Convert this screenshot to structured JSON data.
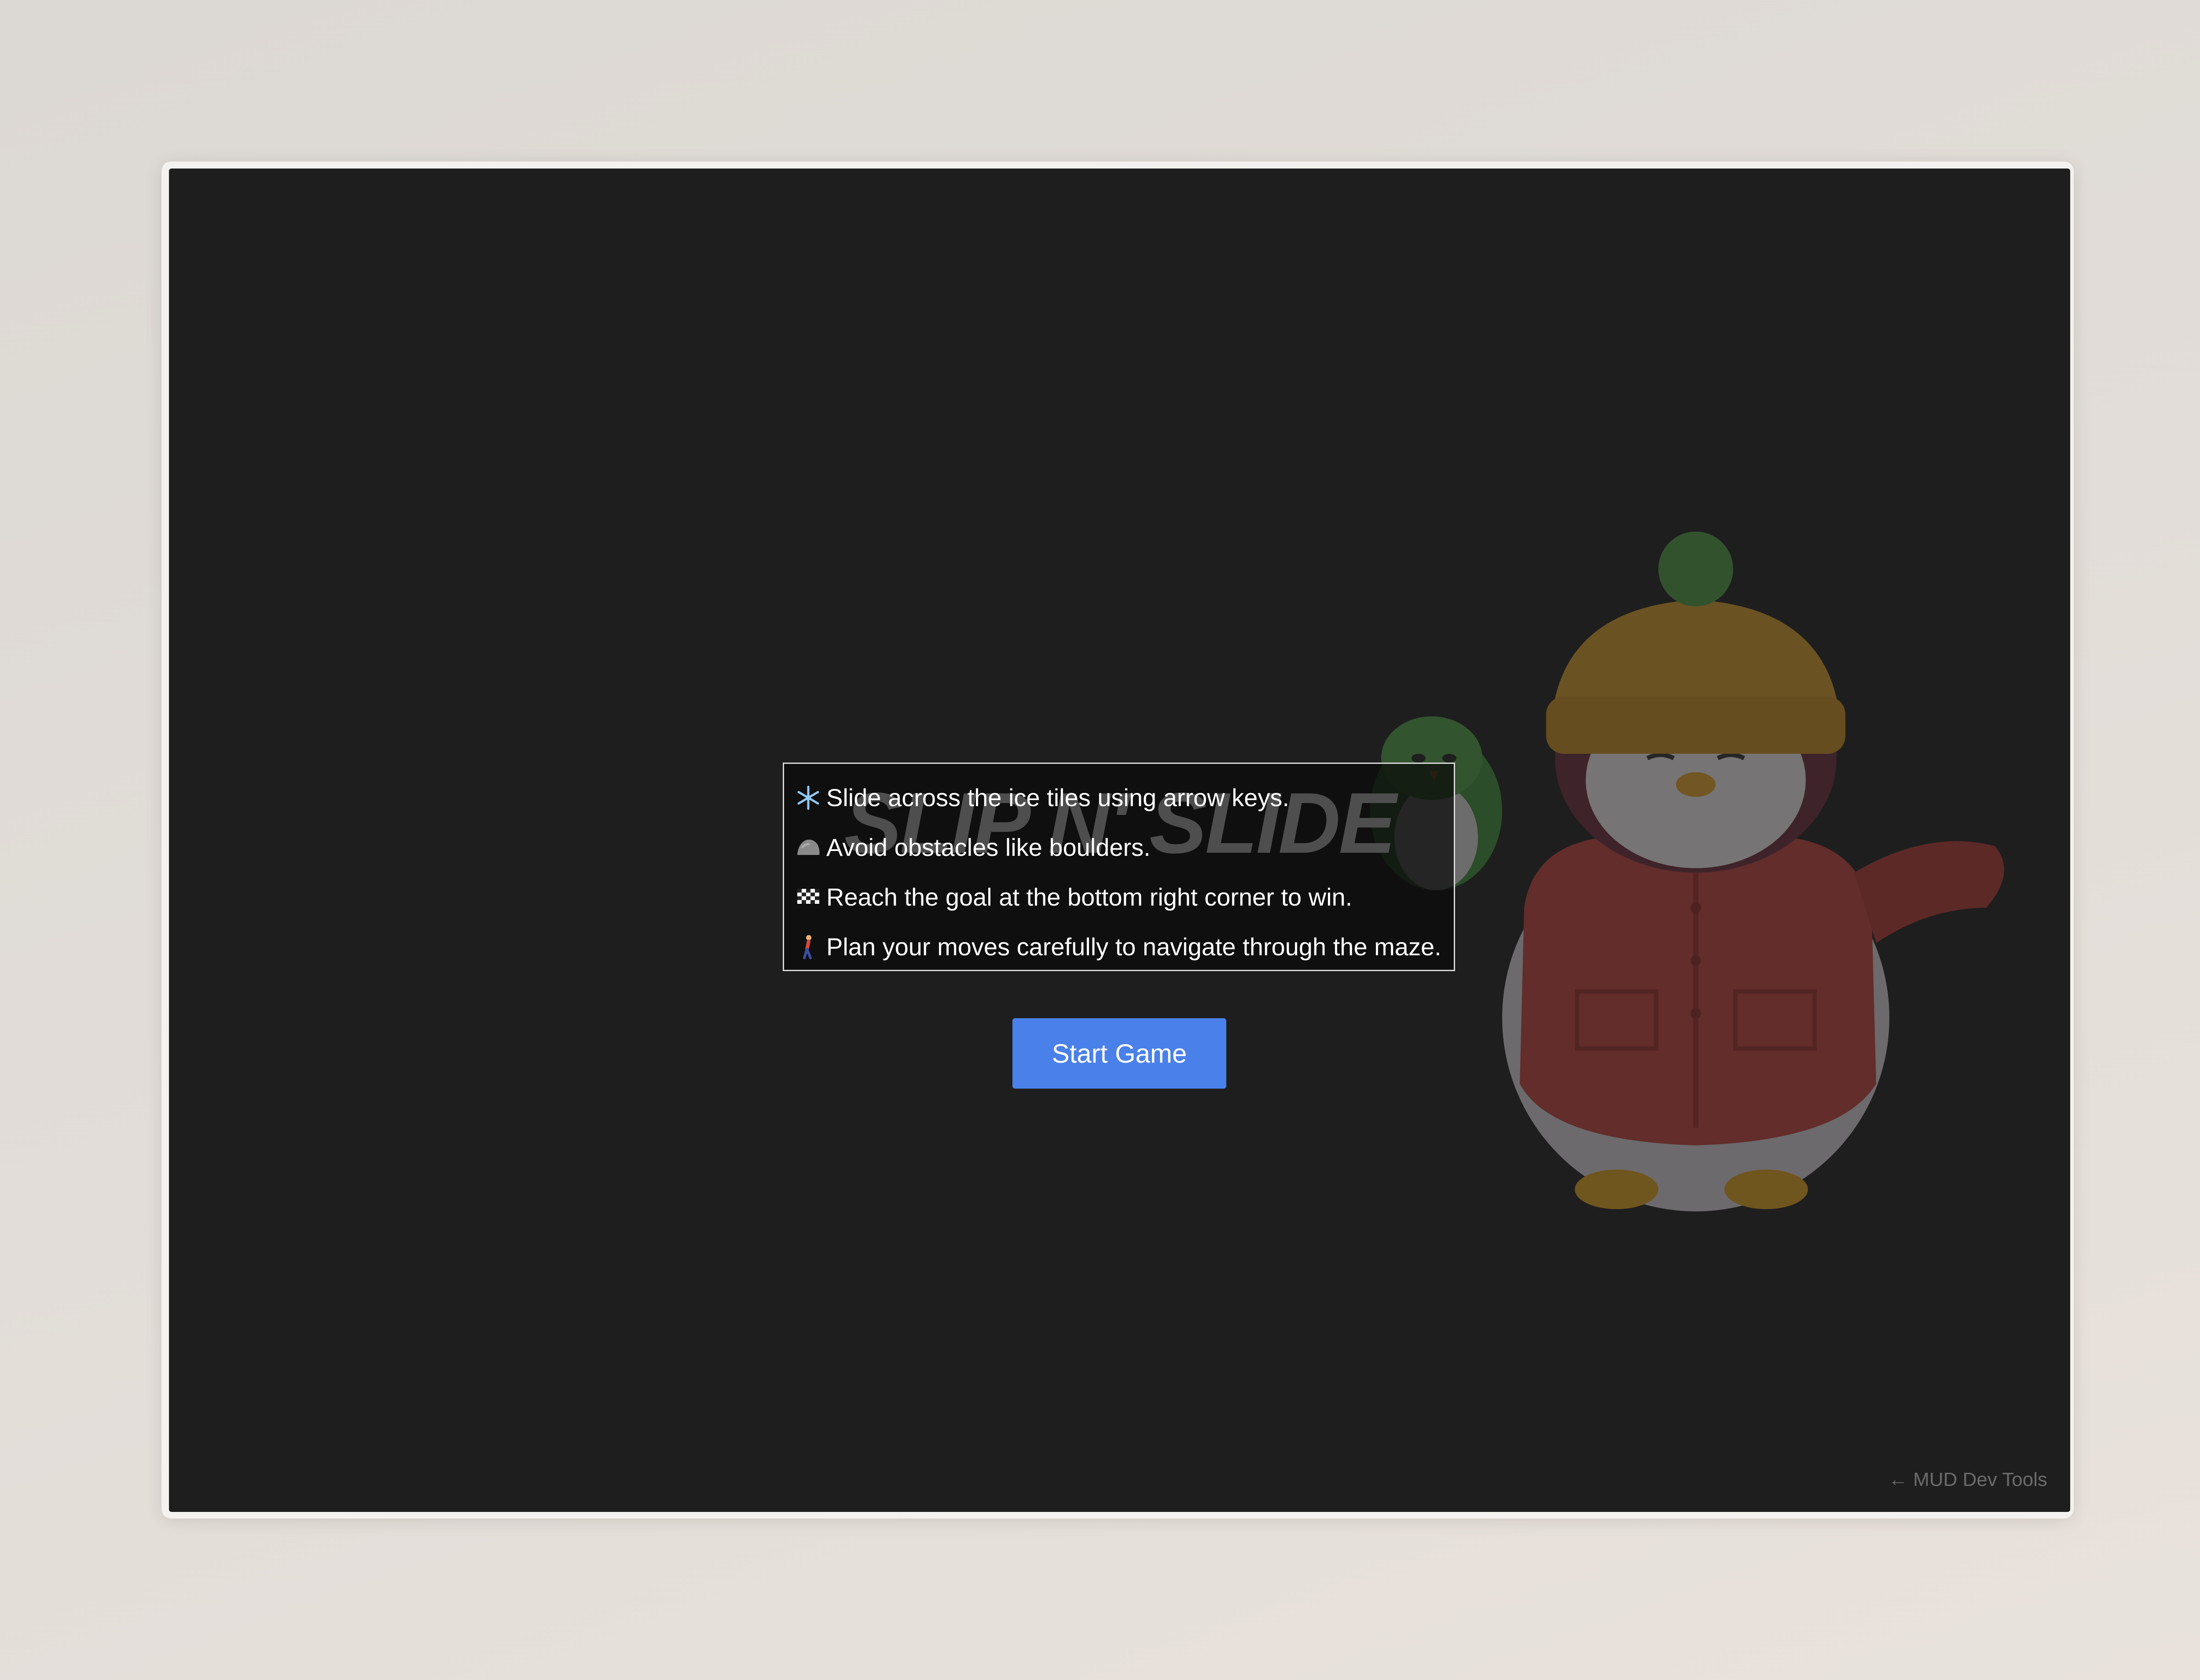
{
  "game": {
    "title": "SLIP N' SLIDE",
    "instructions": [
      {
        "icon": "snowflake-icon",
        "text": "Slide across the ice tiles using arrow keys."
      },
      {
        "icon": "rock-icon",
        "text": "Avoid obstacles like boulders."
      },
      {
        "icon": "checkered-flag-icon",
        "text": "Reach the goal at the bottom right corner to win."
      },
      {
        "icon": "person-walking-icon",
        "text": "Plan your moves carefully to navigate through the maze."
      }
    ],
    "start_label": "Start Game",
    "mascot": "penguin-mascot"
  },
  "devtools": {
    "label": "← MUD Dev Tools"
  },
  "colors": {
    "background": "#1e1e1e",
    "accent": "#4a80ea",
    "text": "#ffffff"
  }
}
